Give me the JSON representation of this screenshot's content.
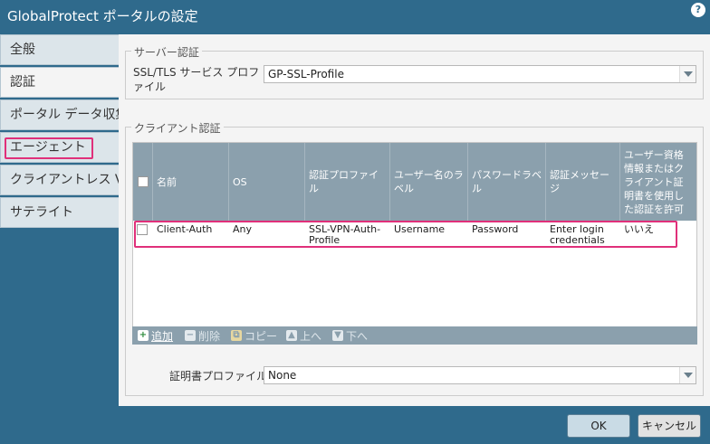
{
  "dialog": {
    "title": "GlobalProtect ポータルの設定",
    "help_glyph": "?"
  },
  "tabs": [
    {
      "label": "全般"
    },
    {
      "label": "認証"
    },
    {
      "label": "ポータル データ収集"
    },
    {
      "label": "エージェント"
    },
    {
      "label": "クライアントレス VPN"
    },
    {
      "label": "サテライト"
    }
  ],
  "server_auth": {
    "legend": "サーバー認証",
    "profile_label": "SSL/TLS サービス プロファイル",
    "profile_value": "GP-SSL-Profile"
  },
  "client_auth": {
    "legend": "クライアント認証",
    "columns": [
      "名前",
      "OS",
      "認証プロファイル",
      "ユーザー名のラベル",
      "パスワードラベル",
      "認証メッセージ",
      "ユーザー資格情報またはクライアント証明書を使用した認証を許可"
    ],
    "rows": [
      {
        "name": "Client-Auth",
        "os": "Any",
        "auth_profile": "SSL-VPN-Auth-Profile",
        "username_label": "Username",
        "password_label": "Password",
        "auth_message": "Enter login credentials",
        "allow": "いいえ"
      }
    ],
    "toolbar": {
      "add": "追加",
      "delete": "削除",
      "copy": "コピー",
      "up": "上へ",
      "down": "下へ"
    },
    "cert_profile_label": "証明書プロファイル",
    "cert_profile_value": "None"
  },
  "footer": {
    "ok": "OK",
    "cancel": "キャンセル"
  }
}
